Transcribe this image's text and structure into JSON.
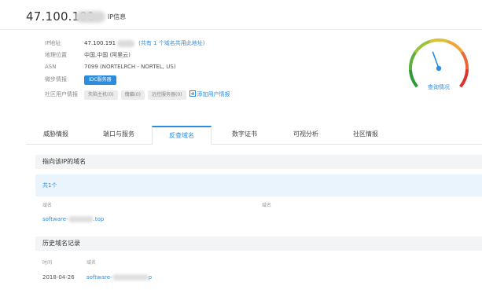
{
  "header": {
    "ip_prefix": "47.100.191",
    "suffix": "IP信息"
  },
  "info": {
    "ip_label": "IP地址",
    "ip_value": "47.100.191",
    "shared_text": "(共有 1 个域名共用此地址)",
    "geo_label": "地理位置",
    "geo_value": "中国,中国 (阿里云)",
    "asn_label": "ASN",
    "asn_value": "7099   (NORTELRCH - NORTEL, US)",
    "intel_label": "微步情报",
    "intel_badge": "IDC服务器",
    "community_label": "社区用户情报",
    "tags": [
      "失陷主机(0)",
      "傀儡(0)",
      "远控服务器(0)"
    ],
    "add_intel": "添加用户情报"
  },
  "gauge": {
    "label": "查询情况",
    "level": 0.42,
    "colors": [
      "#2e9b3a",
      "#5fb03a",
      "#9cc43a",
      "#d9c23a",
      "#f0a53a",
      "#e86a3a",
      "#d9342f"
    ]
  },
  "tabs": [
    {
      "label": "威胁情报",
      "active": false
    },
    {
      "label": "端口与服务",
      "active": false
    },
    {
      "label": "反查域名",
      "active": true
    },
    {
      "label": "数字证书",
      "active": false
    },
    {
      "label": "可视分析",
      "active": false
    },
    {
      "label": "社区情报",
      "active": false
    }
  ],
  "section1": {
    "title": "指向该IP的域名",
    "count": "共1个",
    "col_domain": "域名",
    "col_domain2": "域名",
    "domain_prefix": "software-",
    "domain_suffix": ".top"
  },
  "section2": {
    "title": "历史域名记录",
    "col_time": "时间",
    "col_domain": "域名",
    "date": "2018-04-26",
    "domain_prefix": "software-",
    "domain_suffix": "p"
  },
  "colors": {
    "accent": "#2b8de0"
  }
}
